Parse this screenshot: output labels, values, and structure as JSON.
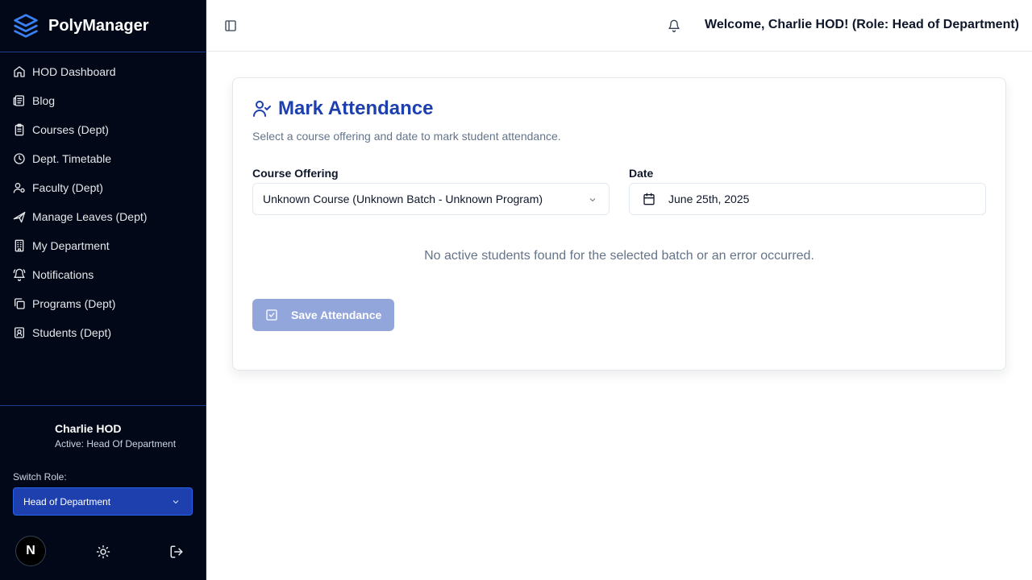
{
  "brand": {
    "name": "PolyManager",
    "logo_icon": "layers-icon",
    "accent": "#3b82f6"
  },
  "sidebar": {
    "items": [
      {
        "label": "HOD Dashboard",
        "icon": "home-icon"
      },
      {
        "label": "Blog",
        "icon": "newspaper-icon"
      },
      {
        "label": "Courses (Dept)",
        "icon": "clipboard-icon"
      },
      {
        "label": "Dept. Timetable",
        "icon": "clock-icon"
      },
      {
        "label": "Faculty (Dept)",
        "icon": "user-cog-icon"
      },
      {
        "label": "Manage Leaves (Dept)",
        "icon": "plane-icon"
      },
      {
        "label": "My Department",
        "icon": "building-icon"
      },
      {
        "label": "Notifications",
        "icon": "bell-ring-icon"
      },
      {
        "label": "Programs (Dept)",
        "icon": "copy-icon"
      },
      {
        "label": "Students (Dept)",
        "icon": "contact-icon"
      }
    ],
    "footer": {
      "user_name": "Charlie HOD",
      "user_role": "Active: Head Of Department",
      "switch_label": "Switch Role:",
      "role_selected": "Head of Department",
      "avatar_letter": "N"
    }
  },
  "header": {
    "welcome": "Welcome, Charlie HOD! (Role: Head of Department)"
  },
  "main": {
    "title": "Mark Attendance",
    "description": "Select a course offering and date to mark student attendance.",
    "course_label": "Course Offering",
    "course_value": "Unknown Course (Unknown Batch - Unknown Program)",
    "date_label": "Date",
    "date_value": "June 25th, 2025",
    "empty_message": "No active students found for the selected batch or an error occurred.",
    "save_label": "Save Attendance"
  },
  "colors": {
    "sidebar_bg": "#020817",
    "primary": "#1e40af",
    "button_disabled": "#93a6dc"
  }
}
